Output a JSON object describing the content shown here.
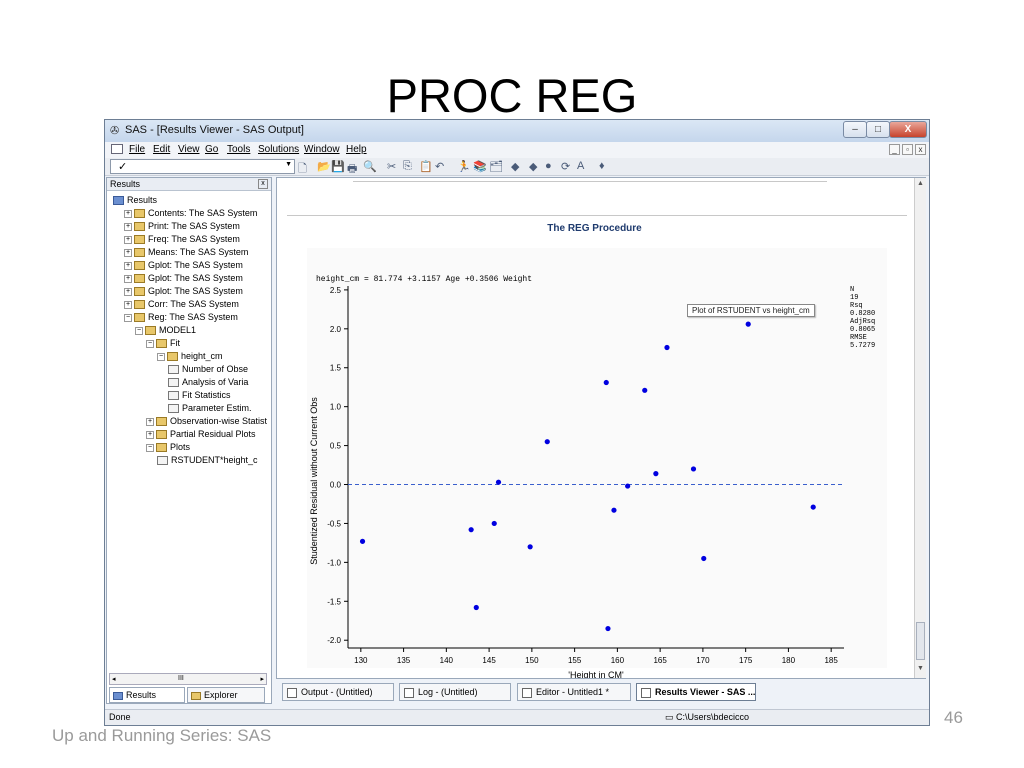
{
  "slide": {
    "title": "PROC REG",
    "footer": "Up and Running Series: SAS",
    "number": "46"
  },
  "window": {
    "title": "SAS - [Results Viewer - SAS Output]",
    "min": "–",
    "max": "□",
    "close": "X"
  },
  "menu": {
    "items": [
      "File",
      "Edit",
      "View",
      "Go",
      "Tools",
      "Solutions",
      "Window",
      "Help"
    ],
    "mdi": [
      "_",
      "▫",
      "x"
    ]
  },
  "toolbar": {
    "command_check": "✓",
    "command_value": "",
    "icons": [
      "new-icon",
      "open-icon",
      "save-icon",
      "print-icon",
      "print-preview-icon",
      "cut-icon",
      "copy-icon",
      "paste-icon",
      "undo-icon",
      "submit-icon",
      "libraries-icon",
      "explorer-icon",
      "back-icon",
      "forward-icon",
      "stop-icon",
      "refresh-icon",
      "font-icon",
      "help-icon"
    ],
    "glyphs": [
      "🗋",
      "📂",
      "💾",
      "🖶",
      "🔍",
      "✂",
      "⎘",
      "📋",
      "↶",
      "🏃",
      "📚",
      "🗂",
      "◆",
      "◆",
      "●",
      "⟳",
      "A",
      "♦"
    ]
  },
  "results": {
    "header": "Results",
    "close": "x",
    "tree": [
      {
        "label": "Results",
        "level": 0,
        "exp": "",
        "icon": "blue"
      },
      {
        "label": "Contents:  The SAS System",
        "level": 1,
        "exp": "+",
        "icon": "folder"
      },
      {
        "label": "Print:  The SAS System",
        "level": 1,
        "exp": "+",
        "icon": "folder"
      },
      {
        "label": "Freq:  The SAS System",
        "level": 1,
        "exp": "+",
        "icon": "folder"
      },
      {
        "label": "Means:  The SAS System",
        "level": 1,
        "exp": "+",
        "icon": "folder"
      },
      {
        "label": "Gplot:  The SAS System",
        "level": 1,
        "exp": "+",
        "icon": "folder"
      },
      {
        "label": "Gplot:  The SAS System",
        "level": 1,
        "exp": "+",
        "icon": "folder"
      },
      {
        "label": "Gplot:  The SAS System",
        "level": 1,
        "exp": "+",
        "icon": "folder"
      },
      {
        "label": "Corr:  The SAS System",
        "level": 1,
        "exp": "+",
        "icon": "folder"
      },
      {
        "label": "Reg:  The SAS System",
        "level": 1,
        "exp": "−",
        "icon": "folder"
      },
      {
        "label": "MODEL1",
        "level": 2,
        "exp": "−",
        "icon": "folder"
      },
      {
        "label": "Fit",
        "level": 3,
        "exp": "−",
        "icon": "folder"
      },
      {
        "label": "height_cm",
        "level": 4,
        "exp": "−",
        "icon": "folder"
      },
      {
        "label": "Number of Obse",
        "level": 5,
        "exp": "",
        "icon": "page"
      },
      {
        "label": "Analysis of Varia",
        "level": 5,
        "exp": "",
        "icon": "page"
      },
      {
        "label": "Fit Statistics",
        "level": 5,
        "exp": "",
        "icon": "page"
      },
      {
        "label": "Parameter Estim.",
        "level": 5,
        "exp": "",
        "icon": "page"
      },
      {
        "label": "Observation-wise Statist",
        "level": 3,
        "exp": "+",
        "icon": "folder"
      },
      {
        "label": "Partial Residual Plots",
        "level": 3,
        "exp": "+",
        "icon": "folder"
      },
      {
        "label": "Plots",
        "level": 3,
        "exp": "−",
        "icon": "folder"
      },
      {
        "label": "RSTUDENT*height_c",
        "level": 4,
        "exp": "",
        "icon": "page"
      }
    ],
    "tabs": [
      "Results",
      "Explorer"
    ],
    "scroll_mid": "III"
  },
  "output": {
    "heading": "The REG Procedure",
    "equation": "height_cm = 81.774 +3.1157 Age +0.3506 Weight",
    "tooltip": "Plot of RSTUDENT vs height_cm",
    "stats": [
      "N",
      "19",
      "Rsq",
      "0.8280",
      "AdjRsq",
      "0.8065",
      "RMSE",
      "5.7279"
    ]
  },
  "chart_data": {
    "type": "scatter",
    "xlabel": "'Height in CM'",
    "ylabel": "Studentized Residual without Current Obs",
    "xlim": [
      128.5,
      186.5
    ],
    "ylim": [
      -2.1,
      2.55
    ],
    "xticks": [
      130,
      135,
      140,
      145,
      150,
      155,
      160,
      165,
      170,
      175,
      180,
      185
    ],
    "yticks": [
      2.5,
      2.0,
      1.5,
      1.0,
      0.5,
      0.0,
      -0.5,
      -1.0,
      -1.5,
      -2.0
    ],
    "ytick_labels": [
      "2.5",
      "2.0",
      "1.5",
      "1.0",
      "0.5",
      "0.0",
      "-0.5",
      "-1.0",
      "-1.5",
      "-2.0"
    ],
    "reference_line_y": 0.0,
    "point_color": "#0000e0",
    "ref_color": "#3a5fcd",
    "points": [
      {
        "x": 130.2,
        "y": -0.73
      },
      {
        "x": 142.9,
        "y": -0.58
      },
      {
        "x": 143.5,
        "y": -1.58
      },
      {
        "x": 145.6,
        "y": -0.5
      },
      {
        "x": 146.1,
        "y": 0.03
      },
      {
        "x": 149.8,
        "y": -0.8
      },
      {
        "x": 151.8,
        "y": 0.55
      },
      {
        "x": 158.7,
        "y": 1.31
      },
      {
        "x": 158.9,
        "y": -1.85
      },
      {
        "x": 159.6,
        "y": -0.33
      },
      {
        "x": 161.2,
        "y": -0.02
      },
      {
        "x": 163.2,
        "y": 1.21
      },
      {
        "x": 164.5,
        "y": 0.14
      },
      {
        "x": 165.8,
        "y": 1.76
      },
      {
        "x": 168.9,
        "y": 0.2
      },
      {
        "x": 170.1,
        "y": -0.95
      },
      {
        "x": 175.3,
        "y": 2.06
      },
      {
        "x": 182.9,
        "y": -0.29
      }
    ]
  },
  "tasks": [
    {
      "label": "Output - (Untitled)",
      "active": false
    },
    {
      "label": "Log - (Untitled)",
      "active": false
    },
    {
      "label": "Editor - Untitled1 *",
      "active": false
    },
    {
      "label": "Results Viewer - SAS ...",
      "active": true
    }
  ],
  "status": {
    "text": "Done",
    "path": "C:\\Users\\bdecicco"
  }
}
